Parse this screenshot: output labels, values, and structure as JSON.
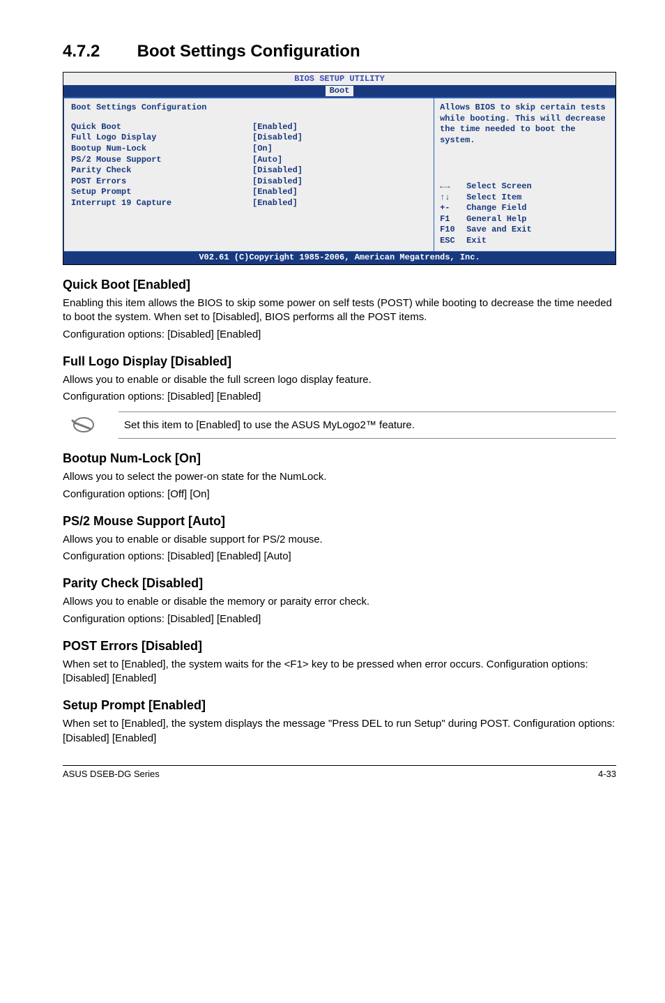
{
  "heading": {
    "number": "4.7.2",
    "title": "Boot Settings Configuration"
  },
  "bios": {
    "header": "BIOS SETUP UTILITY",
    "tab": "Boot",
    "left_title": "Boot Settings Configuration",
    "rows": [
      {
        "label": "Quick Boot",
        "value": "[Enabled]"
      },
      {
        "label": "Full Logo Display",
        "value": "[Disabled]"
      },
      {
        "label": "Bootup Num-Lock",
        "value": "[On]"
      },
      {
        "label": "PS/2 Mouse Support",
        "value": "[Auto]"
      },
      {
        "label": "Parity Check",
        "value": "[Disabled]"
      },
      {
        "label": "POST Errors",
        "value": "[Disabled]"
      },
      {
        "label": "Setup Prompt",
        "value": "[Enabled]"
      },
      {
        "label": "Interrupt 19 Capture",
        "value": "[Enabled]"
      }
    ],
    "help": "Allows BIOS to skip certain tests while booting. This will decrease the time needed to boot the system.",
    "nav": [
      {
        "key": "←→",
        "text": "Select Screen"
      },
      {
        "key": "↑↓",
        "text": "Select Item"
      },
      {
        "key": "+-",
        "text": "Change Field"
      },
      {
        "key": "F1",
        "text": "General Help"
      },
      {
        "key": "F10",
        "text": "Save and Exit"
      },
      {
        "key": "ESC",
        "text": "Exit"
      }
    ],
    "footer": "V02.61 (C)Copyright 1985-2006, American Megatrends, Inc."
  },
  "sections": {
    "quick_boot": {
      "title": "Quick Boot [Enabled]",
      "body": "Enabling this item allows the BIOS to skip some power on self tests (POST) while booting to decrease the time needed to boot the system. When set to [Disabled], BIOS performs all the POST items.",
      "conf": "Configuration options: [Disabled] [Enabled]"
    },
    "full_logo": {
      "title": "Full Logo Display [Disabled]",
      "body": "Allows you to enable or disable the full screen logo display feature.",
      "conf": "Configuration options: [Disabled] [Enabled]"
    },
    "note": "Set this item to [Enabled] to use the ASUS MyLogo2™ feature.",
    "bootup_numlock": {
      "title": "Bootup Num-Lock [On]",
      "body": "Allows you to select the power-on state for the NumLock.",
      "conf": "Configuration options: [Off] [On]"
    },
    "ps2": {
      "title": "PS/2 Mouse Support [Auto]",
      "body": "Allows you to enable or disable support for PS/2 mouse.",
      "conf": "Configuration options: [Disabled] [Enabled] [Auto]"
    },
    "parity": {
      "title": "Parity Check [Disabled]",
      "body": "Allows you to enable or disable the memory or paraity error check.",
      "conf": "Configuration options: [Disabled] [Enabled]"
    },
    "post_errors": {
      "title": "POST Errors [Disabled]",
      "body": "When set to [Enabled], the system waits for the <F1> key to be pressed when error occurs. Configuration options: [Disabled] [Enabled]"
    },
    "setup_prompt": {
      "title": "Setup Prompt [Enabled]",
      "body": "When set to [Enabled], the system displays the message \"Press DEL to run Setup\" during POST. Configuration options: [Disabled] [Enabled]"
    }
  },
  "footer": {
    "left": "ASUS DSEB-DG Series",
    "right": "4-33"
  }
}
